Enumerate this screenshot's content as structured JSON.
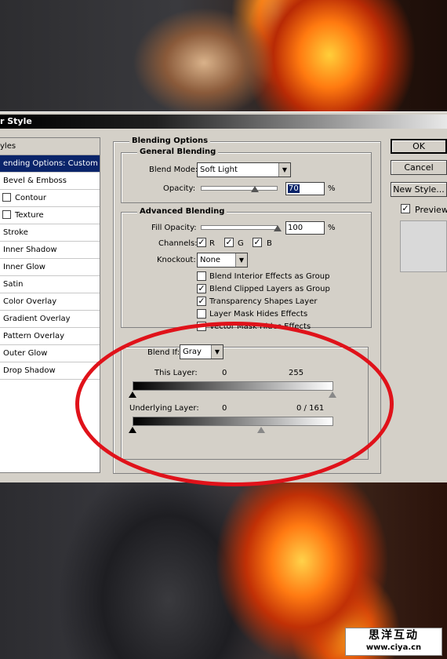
{
  "watermark": {
    "brand": "思洋互动",
    "url": "www.ciya.cn"
  },
  "dialog": {
    "title": "r Style",
    "styles_list": {
      "header": "yles",
      "items": [
        {
          "label": "ending Options: Custom",
          "selected": true,
          "checkbox": false
        },
        {
          "label": "Bevel & Emboss",
          "checkbox": true,
          "checked": false
        },
        {
          "label": "Contour",
          "checkbox": true,
          "checked": false,
          "indent": true
        },
        {
          "label": "Texture",
          "checkbox": true,
          "checked": false,
          "indent": true
        },
        {
          "label": "Stroke",
          "checkbox": true,
          "checked": false
        },
        {
          "label": "Inner Shadow",
          "checkbox": true,
          "checked": false
        },
        {
          "label": "Inner Glow",
          "checkbox": true,
          "checked": false
        },
        {
          "label": "Satin",
          "checkbox": true,
          "checked": false
        },
        {
          "label": "Color Overlay",
          "checkbox": true,
          "checked": false
        },
        {
          "label": "Gradient Overlay",
          "checkbox": true,
          "checked": false
        },
        {
          "label": "Pattern Overlay",
          "checkbox": true,
          "checked": false
        },
        {
          "label": "Outer Glow",
          "checkbox": true,
          "checked": false
        },
        {
          "label": "Drop Shadow",
          "checkbox": true,
          "checked": false
        }
      ]
    },
    "blending_options": {
      "title": "Blending Options",
      "general": {
        "title": "General Blending",
        "blend_mode_label": "Blend Mode:",
        "blend_mode_value": "Soft Light",
        "opacity_label": "Opacity:",
        "opacity_value": "70",
        "opacity_unit": "%",
        "opacity_fraction": 0.7
      },
      "advanced": {
        "title": "Advanced Blending",
        "fill_opacity_label": "Fill Opacity:",
        "fill_opacity_value": "100",
        "fill_opacity_unit": "%",
        "fill_opacity_fraction": 1.0,
        "channels_label": "Channels:",
        "channels": [
          {
            "label": "R",
            "checked": true
          },
          {
            "label": "G",
            "checked": true
          },
          {
            "label": "B",
            "checked": true
          }
        ],
        "knockout_label": "Knockout:",
        "knockout_value": "None",
        "options": [
          {
            "label": "Blend Interior Effects as Group",
            "checked": false
          },
          {
            "label": "Blend Clipped Layers as Group",
            "checked": true
          },
          {
            "label": "Transparency Shapes Layer",
            "checked": true
          },
          {
            "label": "Layer Mask Hides Effects",
            "checked": false
          },
          {
            "label": "Vector Mask Hides Effects",
            "checked": false
          }
        ]
      },
      "blend_if": {
        "label": "Blend If:",
        "value": "Gray",
        "this_layer_label": "This Layer:",
        "this_layer_low": "0",
        "this_layer_high": "255",
        "underlying_label": "Underlying Layer:",
        "underlying_low": "0",
        "underlying_high": "0 / 161"
      }
    },
    "buttons": {
      "ok": "OK",
      "cancel": "Cancel",
      "new_style": "New Style..."
    },
    "preview_label": "Preview",
    "preview_checked": true
  }
}
